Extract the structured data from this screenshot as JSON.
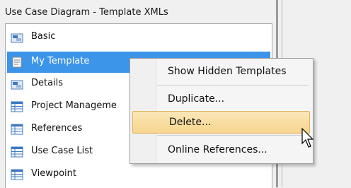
{
  "panel": {
    "title": "Use Case Diagram - Template XMLs"
  },
  "templates": [
    {
      "label": "Basic",
      "icon": "diagram-icon"
    },
    {
      "label": "My Template",
      "icon": "document-icon",
      "selected": true
    },
    {
      "label": "Details",
      "icon": "diagram-icon"
    },
    {
      "label": "Project Manageme",
      "icon": "table-icon"
    },
    {
      "label": "References",
      "icon": "table-icon"
    },
    {
      "label": "Use Case List",
      "icon": "table-icon"
    },
    {
      "label": "Viewpoint",
      "icon": "table-icon"
    }
  ],
  "context_menu": {
    "items": [
      {
        "label": "Show Hidden Templates"
      },
      {
        "label": "Duplicate..."
      },
      {
        "label": "Delete...",
        "highlighted": true
      },
      {
        "label": "Online References..."
      }
    ]
  },
  "colors": {
    "selection": "#3d95ea",
    "menu_highlight": "#f6d58e",
    "icon_blue": "#3a78c4"
  }
}
